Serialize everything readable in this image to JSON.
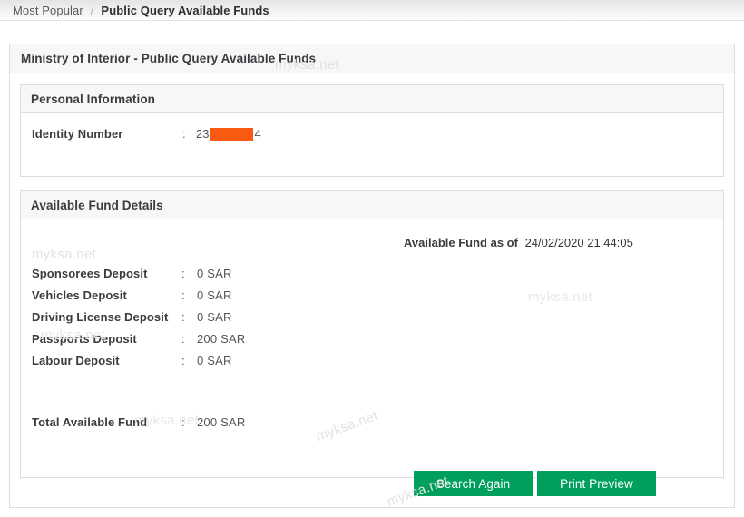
{
  "breadcrumb": {
    "parent": "Most Popular",
    "separator": "/",
    "current": "Public Query Available Funds"
  },
  "page": {
    "title": "Ministry of Interior - Public Query Available Funds"
  },
  "personal_information": {
    "section_title": "Personal Information",
    "identity": {
      "label": "Identity Number",
      "colon": ":",
      "value_prefix": "23",
      "value_suffix": "4",
      "redacted": true,
      "redaction_color": "#fa5a0f"
    }
  },
  "available_fund_details": {
    "section_title": "Available Fund Details",
    "as_of": {
      "label": "Available Fund as of",
      "timestamp": "24/02/2020 21:44:05"
    },
    "colon": ":",
    "rows": [
      {
        "label": "Sponsorees Deposit",
        "value": "0 SAR"
      },
      {
        "label": "Vehicles Deposit",
        "value": "0 SAR"
      },
      {
        "label": "Driving License Deposit",
        "value": "0 SAR"
      },
      {
        "label": "Passports Deposit",
        "value": "200 SAR"
      },
      {
        "label": "Labour Deposit",
        "value": "0 SAR"
      }
    ],
    "total": {
      "label": "Total Available Fund",
      "colon": ":",
      "value": "200 SAR"
    }
  },
  "actions": {
    "search_again": "Search Again",
    "print_preview": "Print Preview",
    "button_color": "#00a05c"
  },
  "watermarks": {
    "text": "myksa.net"
  }
}
